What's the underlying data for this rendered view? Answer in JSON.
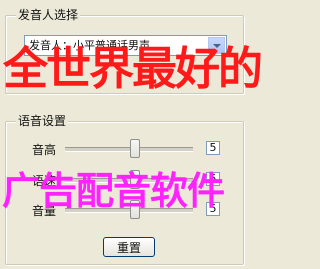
{
  "voice_group": {
    "title": "发音人选择",
    "selected_voice": "发音人：小平普通话男声"
  },
  "speech_group": {
    "title": "语音设置",
    "pitch": {
      "label": "音高",
      "value": "5"
    },
    "speed": {
      "label": "语速",
      "value": "5"
    },
    "volume": {
      "label": "音量",
      "value": "5"
    },
    "reset_label": "重置"
  },
  "overlay": {
    "line1": "全世界最好的",
    "line2": "广告配音软件"
  },
  "colors": {
    "background": "#ece9d8",
    "overlay_line1": "#ff1a1a",
    "overlay_line2": "#ff22ff"
  }
}
